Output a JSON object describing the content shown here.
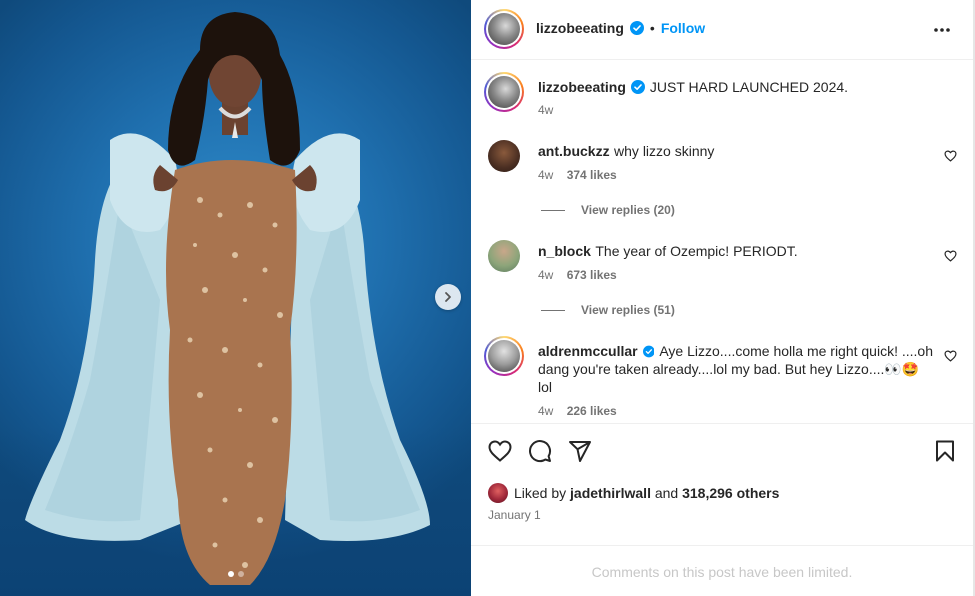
{
  "post": {
    "username": "lizzobeeating",
    "separator": "•",
    "follow_label": "Follow",
    "caption": "JUST HARD LAUNCHED 2024.",
    "caption_time": "4w"
  },
  "comments": [
    {
      "username": "ant.buckzz",
      "text": "why lizzo skinny",
      "time": "4w",
      "likes": "374 likes",
      "replies": "View replies (20)"
    },
    {
      "username": "n_block",
      "text": "The year of Ozempic! PERIODT.",
      "time": "4w",
      "likes": "673 likes",
      "replies": "View replies (51)"
    },
    {
      "username": "aldrenmccullar",
      "text_line1": "Aye Lizzo....come holla me right quick! ....oh",
      "text_line2": "dang you're taken already....lol my bad. But hey Lizzo....👀🤩",
      "text_line3": "lol",
      "time": "4w",
      "likes": "226 likes"
    }
  ],
  "engagement": {
    "liked_by_prefix": "Liked by",
    "liked_by_user": "jadethirlwall",
    "liked_by_and": "and",
    "liked_by_count": "318,296 others",
    "date": "January 1",
    "comments_limited": "Comments on this post have been limited."
  },
  "icons": {
    "more": "more-options-icon",
    "verified": "verified-badge-icon",
    "like": "heart-icon",
    "comment": "comment-icon",
    "share": "share-icon",
    "save": "bookmark-icon",
    "next": "chevron-right-icon"
  },
  "colors": {
    "link": "#0095f6",
    "verified": "#0095f6",
    "muted": "#737373",
    "text": "#262626"
  },
  "carousel": {
    "total_slides": 2,
    "active_slide": 1
  }
}
